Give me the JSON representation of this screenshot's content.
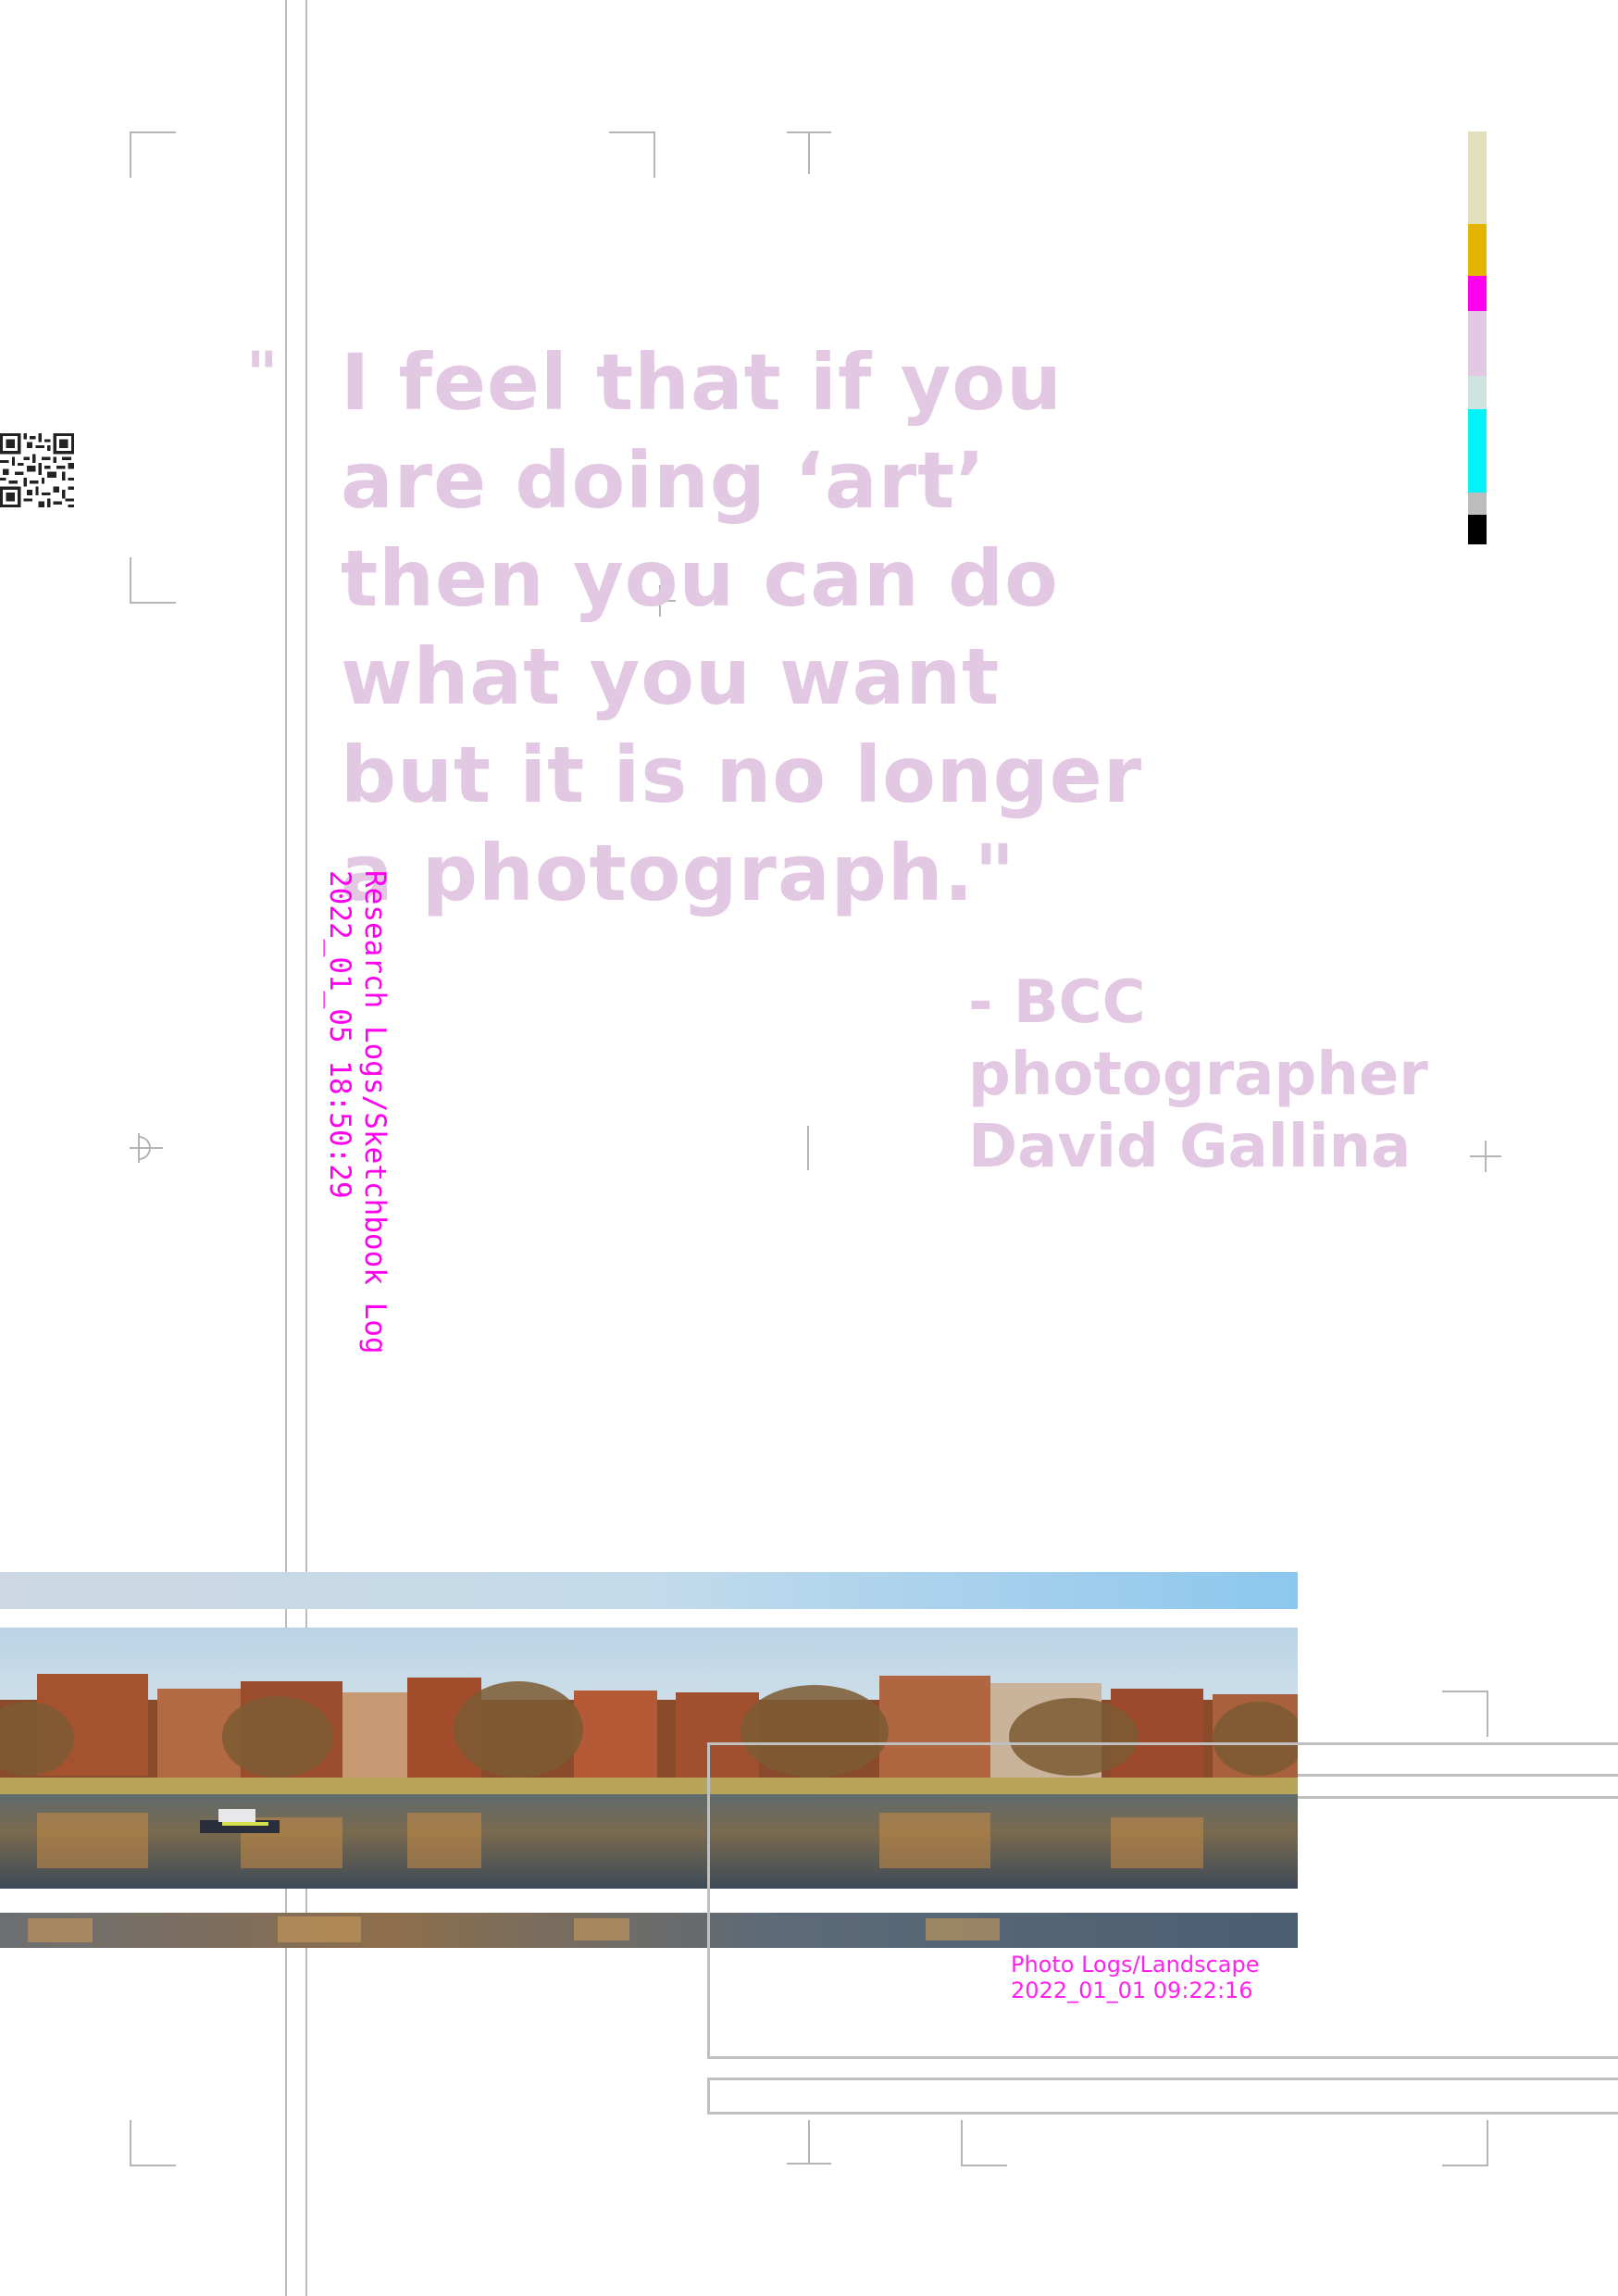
{
  "quote": {
    "open_mark": "\"",
    "lines": [
      "I feel that if you",
      "are doing ‘art’",
      "then you can do",
      "what you want",
      "but it is no longer",
      "a photograph.\""
    ]
  },
  "attribution": {
    "lines": [
      "- BCC",
      "photographer",
      "David Gallina"
    ]
  },
  "sketch_log": {
    "title": "Research Logs/Sketchbook Log",
    "timestamp": "2022_01_05  18:50:29"
  },
  "photo_log": {
    "title": "Photo Logs/Landscape",
    "timestamp": "2022_01_01  09:22:16"
  },
  "colors": {
    "quote_text": "#e2c8e2",
    "log_text": "#ff00ee",
    "swatches": [
      "#e3e1bd",
      "#e5b400",
      "#ff00ee",
      "#e2c8e2",
      "#cfe3e1",
      "#00f4f7",
      "#bdbdbd",
      "#000000"
    ]
  },
  "icons": {
    "qr": "qr-code-icon",
    "registration": "registration-mark-icon"
  }
}
